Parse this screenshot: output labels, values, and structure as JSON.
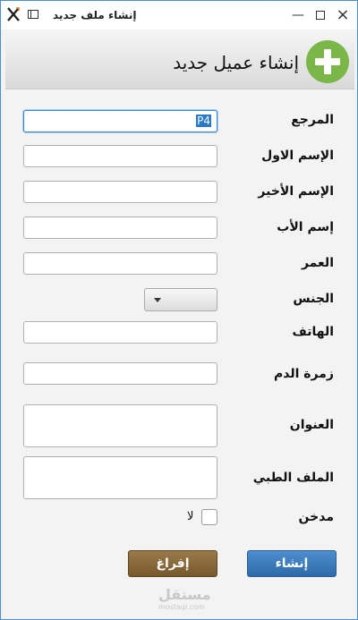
{
  "window": {
    "title": "إنشاء ملف جديد"
  },
  "header": {
    "title": "إنشاء عميل جديد"
  },
  "form": {
    "reference": {
      "label": "المرجع",
      "value": "P4"
    },
    "first_name": {
      "label": "الإسم الاول",
      "value": ""
    },
    "last_name": {
      "label": "الإسم الأخير",
      "value": ""
    },
    "father_name": {
      "label": "إسم الأب",
      "value": ""
    },
    "age": {
      "label": "العمر",
      "value": ""
    },
    "gender": {
      "label": "الجنس",
      "value": ""
    },
    "phone": {
      "label": "الهاتف",
      "value": ""
    },
    "blood_type": {
      "label": "زمرة الدم",
      "value": ""
    },
    "address": {
      "label": "العنوان",
      "value": ""
    },
    "medical_file": {
      "label": "الملف الطبي",
      "value": ""
    },
    "smoker": {
      "label": "مدخن",
      "option_label": "لا",
      "checked": false
    }
  },
  "buttons": {
    "create": "إنشاء",
    "clear": "إفراغ"
  },
  "watermark": {
    "main": "مستقل",
    "sub": "mostaql.com"
  },
  "colors": {
    "accent": "#2e6aa8",
    "clear_button": "#76592e",
    "plus_icon": "#7ab648"
  }
}
